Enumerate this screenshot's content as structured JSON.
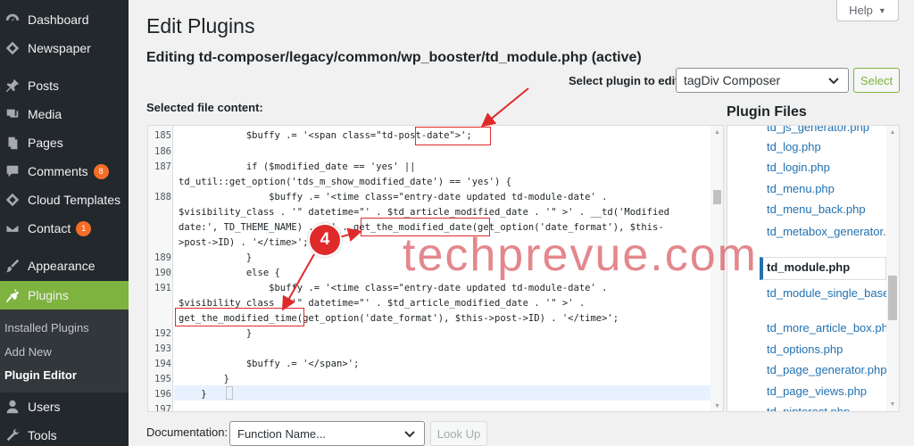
{
  "sidebar": {
    "items": [
      {
        "label": "Dashboard",
        "icon": "dashboard-icon"
      },
      {
        "label": "Newspaper",
        "icon": "newspaper-icon"
      },
      {
        "label": "Posts",
        "icon": "pin-icon"
      },
      {
        "label": "Media",
        "icon": "media-icon"
      },
      {
        "label": "Pages",
        "icon": "pages-icon"
      },
      {
        "label": "Comments",
        "icon": "comment-icon",
        "count": "8"
      },
      {
        "label": "Cloud Templates",
        "icon": "cloud-templates-icon"
      },
      {
        "label": "Contact",
        "icon": "mail-icon",
        "count": "1"
      },
      {
        "label": "Appearance",
        "icon": "brush-icon"
      },
      {
        "label": "Plugins",
        "icon": "plugin-icon"
      },
      {
        "label": "Users",
        "icon": "users-icon"
      },
      {
        "label": "Tools",
        "icon": "tools-icon"
      }
    ],
    "submenu": [
      "Installed Plugins",
      "Add New",
      "Plugin Editor"
    ],
    "accent_color": "#7eb33f"
  },
  "header": {
    "help_label": "Help",
    "page_title": "Edit Plugins",
    "editing_title": "Editing td-composer/legacy/common/wp_booster/td_module.php (active)",
    "select_label": "Select plugin to edit:",
    "select_value": "tagDiv Composer",
    "select_button": "Select",
    "content_label": "Selected file content:"
  },
  "editor": {
    "lines": [
      {
        "num": "185",
        "code": "            $buffy .= '<span class=\"td-post-date\">';"
      },
      {
        "num": "186",
        "code": ""
      },
      {
        "num": "187",
        "code": "            if ($modified_date == 'yes' ||"
      },
      {
        "num": "",
        "code": "td_util::get_option('tds_m_show_modified_date') == 'yes') {"
      },
      {
        "num": "188",
        "code": "                $buffy .= '<time class=\"entry-date updated td-module-date' ."
      },
      {
        "num": "",
        "code": "$visibility_class . '\" datetime=\"' . $td_article_modified_date . '\" >' . __td('Modified"
      },
      {
        "num": "",
        "code": "date:', TD_THEME_NAME) . ' ' . get_the_modified_date(get_option('date_format'), $this-"
      },
      {
        "num": "",
        "code": ">post->ID) . '</time>';"
      },
      {
        "num": "189",
        "code": "            }"
      },
      {
        "num": "190",
        "code": "            else {"
      },
      {
        "num": "191",
        "code": "                $buffy .= '<time class=\"entry-date updated td-module-date' ."
      },
      {
        "num": "",
        "code": "$visibility_class . '\" datetime=\"' . $td_article_modified_date . '\" >' ."
      },
      {
        "num": "",
        "code": "get_the_modified_time(get_option('date_format'), $this->post->ID) . '</time>';"
      },
      {
        "num": "192",
        "code": "            }"
      },
      {
        "num": "193",
        "code": ""
      },
      {
        "num": "194",
        "code": "            $buffy .= '</span>';"
      },
      {
        "num": "195",
        "code": "        }"
      },
      {
        "num": "196",
        "code": "    }"
      },
      {
        "num": "197",
        "code": ""
      }
    ]
  },
  "files": {
    "title": "Plugin Files",
    "items": [
      "td_js_generator.php",
      "td_log.php",
      "td_login.php",
      "td_menu.php",
      "td_menu_back.php",
      "td_metabox_generator.php",
      "td_module.php",
      "td_module_single_base.php",
      "td_more_article_box.php",
      "td_options.php",
      "td_page_generator.php",
      "td_page_views.php",
      "td_pinterest.php"
    ]
  },
  "annotations": {
    "step_badge": "4",
    "watermark": "techprevue.com",
    "highlight_color": "#e02a2a"
  },
  "footer": {
    "doc_label": "Documentation:",
    "doc_placeholder": "Function Name...",
    "lookup_button": "Look Up"
  }
}
